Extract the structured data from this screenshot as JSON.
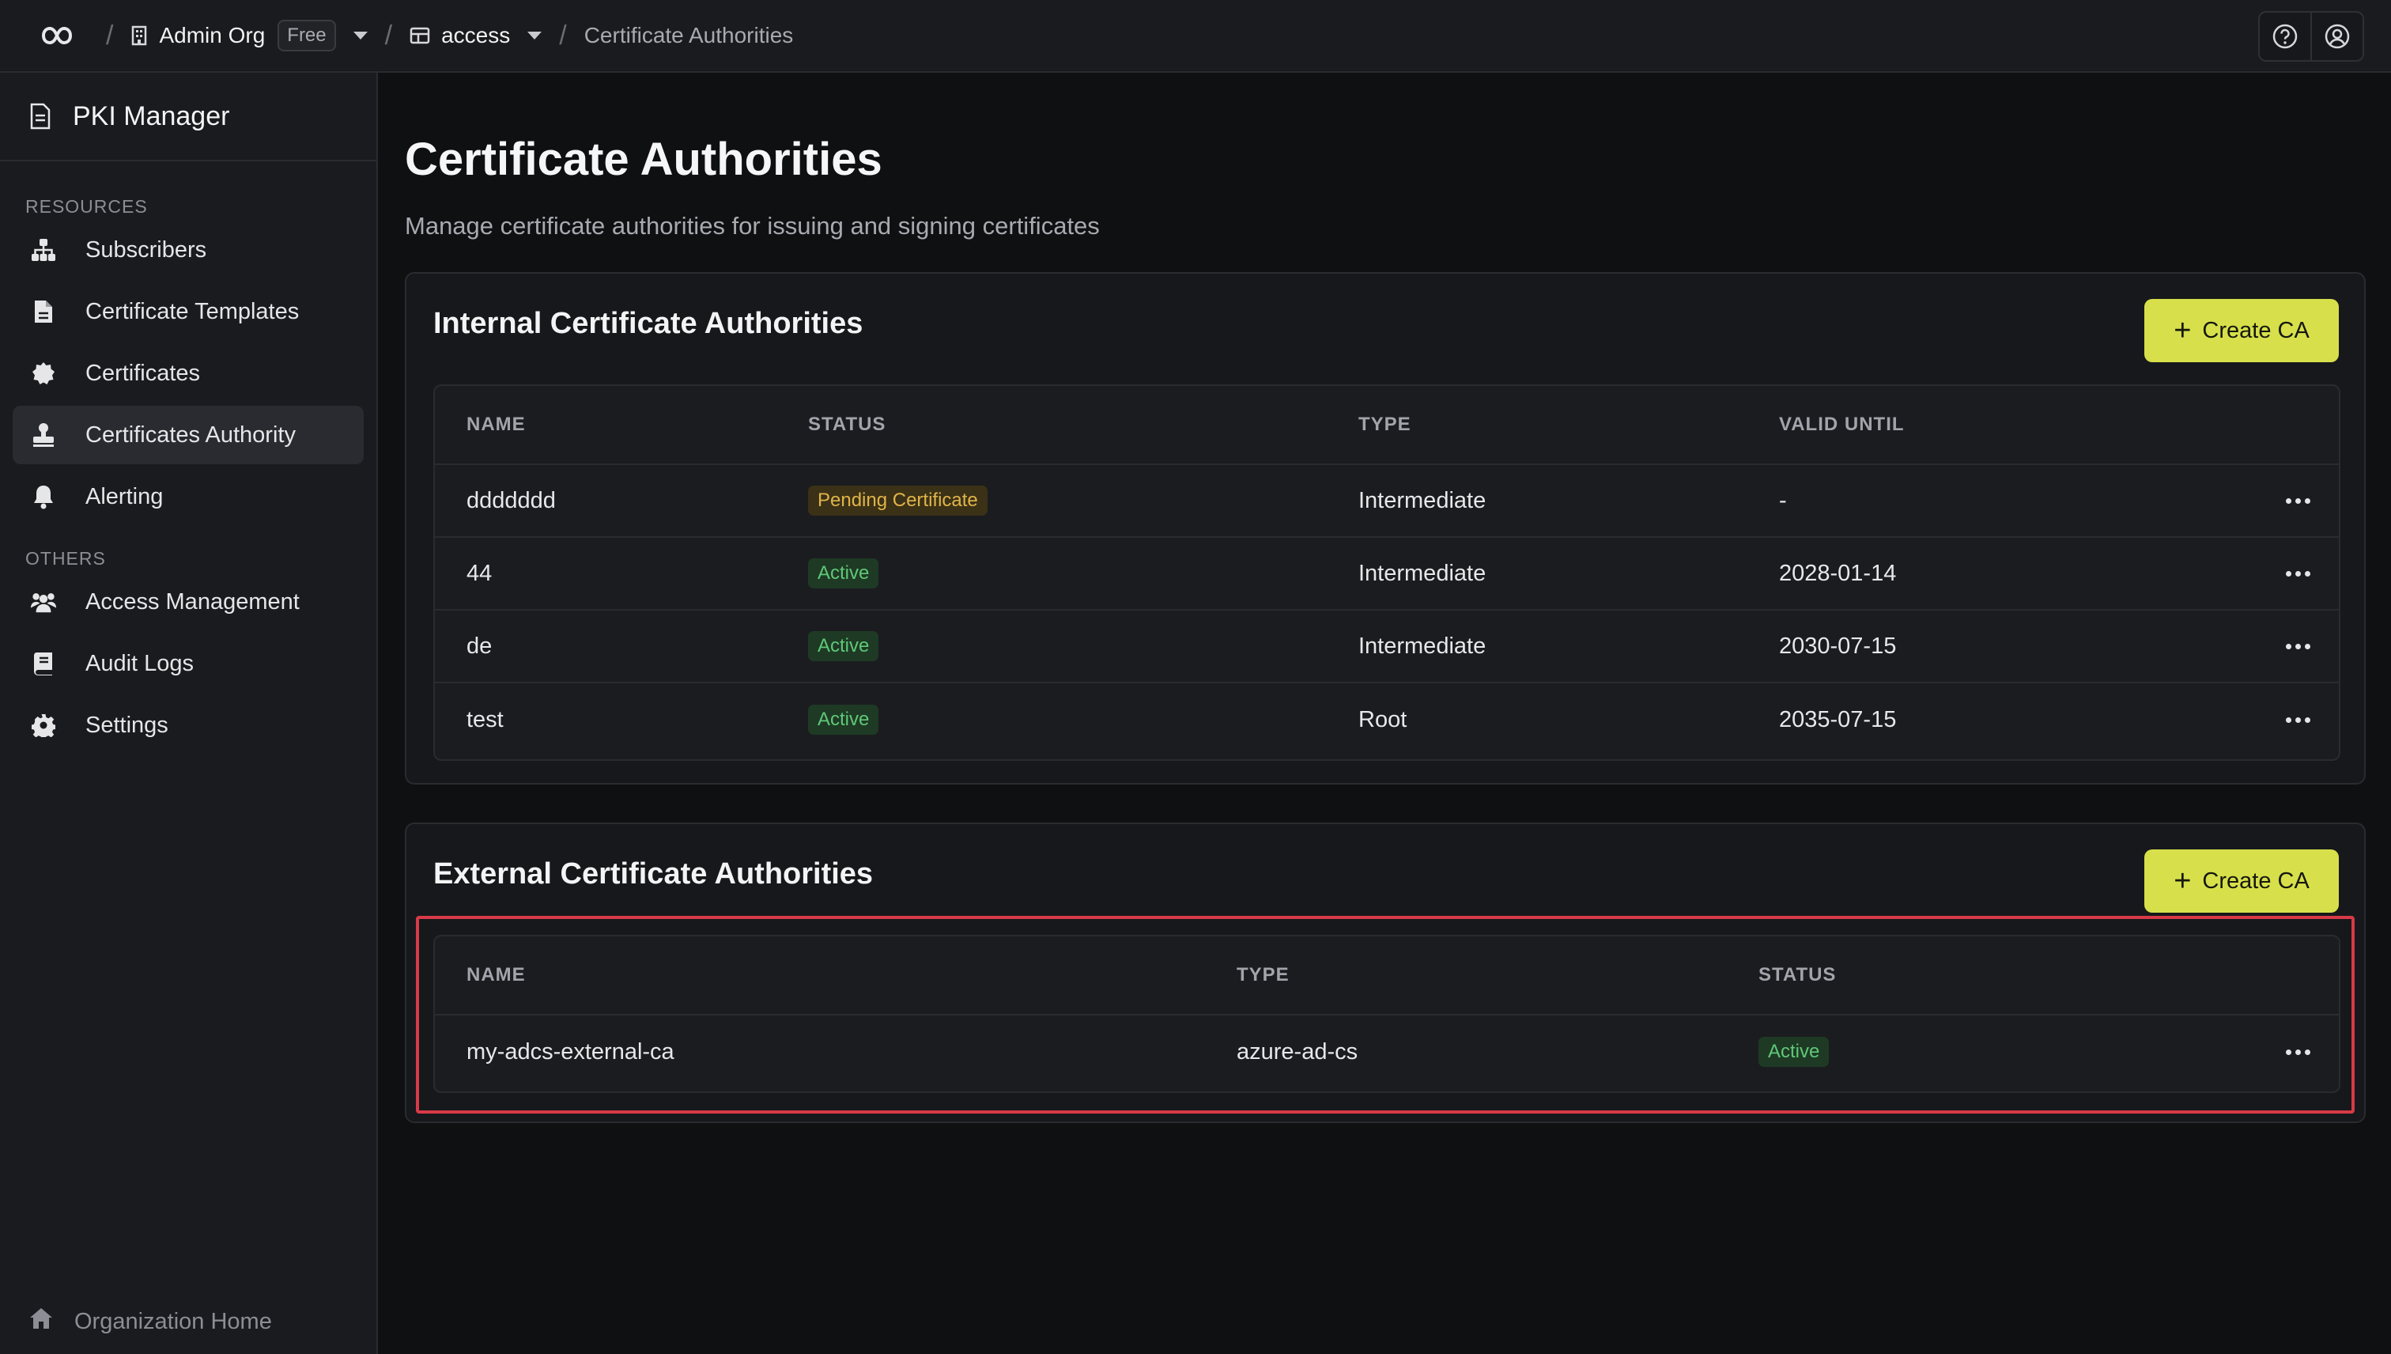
{
  "topbar": {
    "org_name": "Admin Org",
    "plan_badge": "Free",
    "project_name": "access",
    "current_page": "Certificate Authorities",
    "separator": "/"
  },
  "sidebar": {
    "title": "PKI Manager",
    "sections": {
      "resources": "RESOURCES",
      "others": "OTHERS"
    },
    "items": [
      {
        "label": "Subscribers",
        "icon": "sitemap-icon"
      },
      {
        "label": "Certificate Templates",
        "icon": "file-icon"
      },
      {
        "label": "Certificates",
        "icon": "certificate-icon"
      },
      {
        "label": "Certificates Authority",
        "icon": "stamp-icon",
        "active": true
      },
      {
        "label": "Alerting",
        "icon": "bell-icon"
      },
      {
        "label": "Access Management",
        "icon": "users-icon"
      },
      {
        "label": "Audit Logs",
        "icon": "book-icon"
      },
      {
        "label": "Settings",
        "icon": "gear-icon"
      }
    ],
    "footer": "Organization Home"
  },
  "main": {
    "title": "Certificate Authorities",
    "subtitle": "Manage certificate authorities for issuing and signing certificates",
    "internal": {
      "title": "Internal Certificate Authorities",
      "create_label": "Create CA",
      "columns": [
        "NAME",
        "STATUS",
        "TYPE",
        "VALID UNTIL"
      ],
      "rows": [
        {
          "name": "ddddddd",
          "status": "Pending Certificate",
          "type": "Intermediate",
          "valid_until": "-"
        },
        {
          "name": "44",
          "status": "Active",
          "type": "Intermediate",
          "valid_until": "2028-01-14"
        },
        {
          "name": "de",
          "status": "Active",
          "type": "Intermediate",
          "valid_until": "2030-07-15"
        },
        {
          "name": "test",
          "status": "Active",
          "type": "Root",
          "valid_until": "2035-07-15"
        }
      ]
    },
    "external": {
      "title": "External Certificate Authorities",
      "create_label": "Create CA",
      "columns": [
        "NAME",
        "TYPE",
        "STATUS"
      ],
      "rows": [
        {
          "name": "my-adcs-external-ca",
          "type": "azure-ad-cs",
          "status": "Active"
        }
      ]
    }
  },
  "colors": {
    "accent": "#d7e04a",
    "highlight": "#d83a47",
    "active_badge": "#5fc877",
    "pending_badge": "#e0b44a"
  }
}
